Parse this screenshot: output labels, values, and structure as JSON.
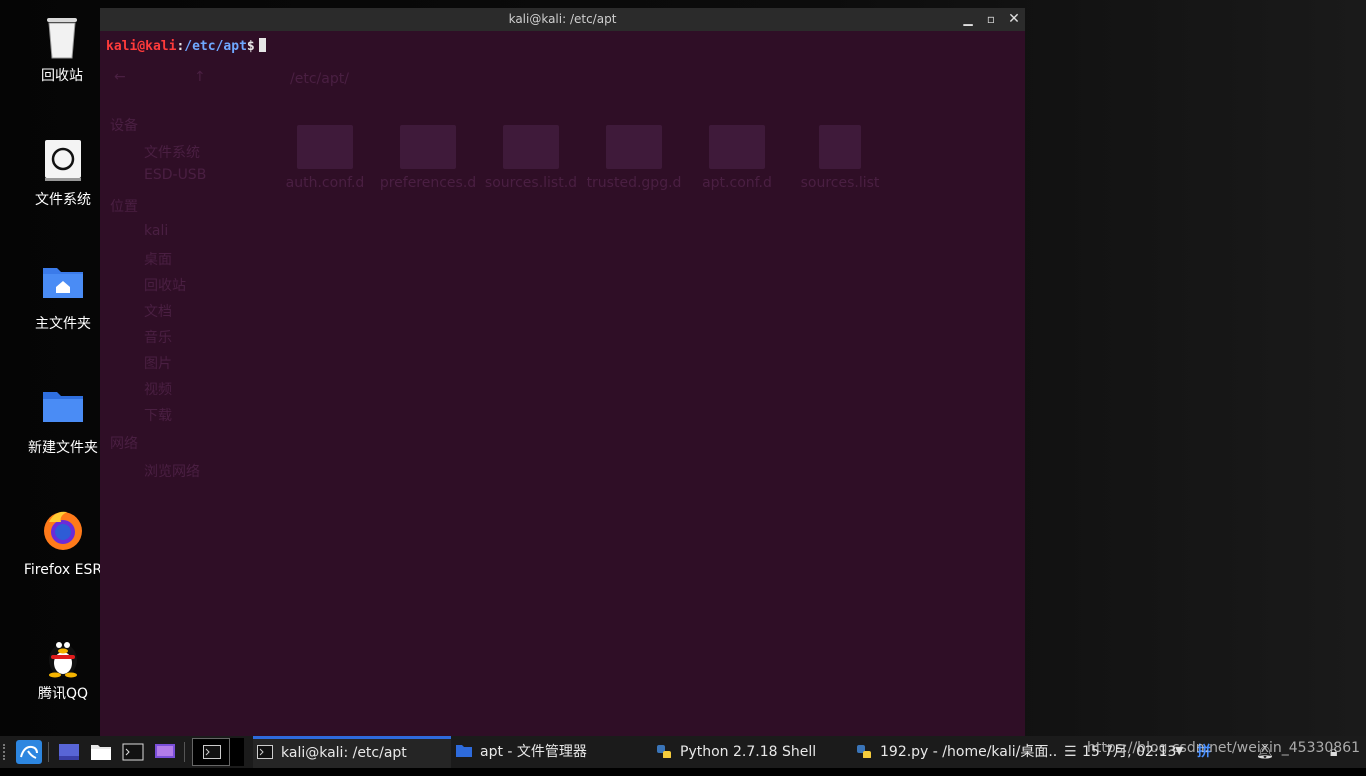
{
  "desktop": {
    "icons": [
      {
        "label": "回收站"
      },
      {
        "label": "文件系统"
      },
      {
        "label": "主文件夹"
      },
      {
        "label": "新建文件夹"
      },
      {
        "label": "Firefox ESR"
      },
      {
        "label": "腾讯QQ"
      }
    ]
  },
  "terminal": {
    "title": "kali@kali: /etc/apt",
    "prompt": {
      "user": "kali@kali",
      "colon": ":",
      "path": "/etc/apt",
      "symbol": "$"
    }
  },
  "background_window": {
    "path": "/etc/apt/",
    "sections": [
      "设备",
      "位置",
      "网络"
    ],
    "devices": [
      "文件系统",
      "ESD-USB"
    ],
    "places": [
      "kali",
      "桌面",
      "回收站",
      "文档",
      "音乐",
      "图片",
      "视频",
      "下载"
    ],
    "network": [
      "浏览网络"
    ],
    "files": [
      "auth.conf.d",
      "preferences.d",
      "sources.list.d",
      "trusted.gpg.d",
      "apt.conf.d",
      "sources.list"
    ]
  },
  "taskbar": {
    "tasks": [
      {
        "label": "kali@kali: /etc/apt"
      },
      {
        "label": "apt - 文件管理器"
      },
      {
        "label": "Python 2.7.18 Shell"
      },
      {
        "label": "192.py - /home/kali/桌面..."
      }
    ],
    "clock": "15 7月, 02:13",
    "input_method": "拼",
    "watermark": "https://blog.csdn.net/weixin_45330861"
  },
  "colors": {
    "terminal_bg": "#2f0e26",
    "prompt_user": "#ff3b3b",
    "prompt_path": "#6fa8ff",
    "accent_blue": "#2e6bdc"
  }
}
